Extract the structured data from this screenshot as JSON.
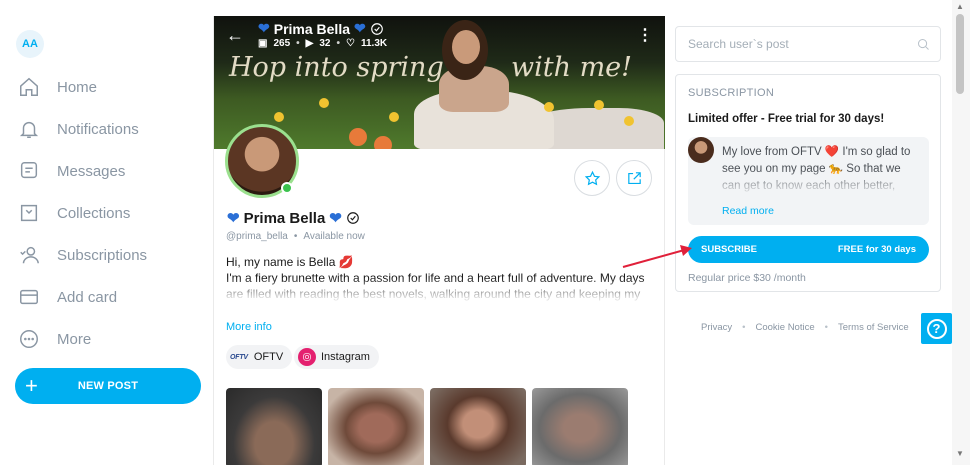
{
  "user": {
    "initials": "AA"
  },
  "nav": {
    "items": [
      {
        "label": "Home",
        "icon": "home-icon"
      },
      {
        "label": "Notifications",
        "icon": "bell-icon"
      },
      {
        "label": "Messages",
        "icon": "message-icon"
      },
      {
        "label": "Collections",
        "icon": "bookmark-icon"
      },
      {
        "label": "Subscriptions",
        "icon": "subscriptions-icon"
      },
      {
        "label": "Add card",
        "icon": "card-icon"
      },
      {
        "label": "More",
        "icon": "more-icon"
      }
    ],
    "new_post": "NEW POST"
  },
  "cover": {
    "name": "Prima Bella",
    "photos": "265",
    "videos": "32",
    "likes": "11.3K",
    "script_left": "Hop into spring",
    "script_right": "with me!"
  },
  "profile": {
    "name": "Prima Bella",
    "handle": "@prima_bella",
    "status": "Available now",
    "bio_line1": "Hi, my name is Bella",
    "bio_line2": "I'm a fiery brunette with a passion for life and a heart full of adventure. My days are filled with reading the best novels, walking around the city and keeping my",
    "more_info": "More info",
    "links": [
      {
        "label": "OFTV",
        "logo": "OFTV"
      },
      {
        "label": "Instagram"
      }
    ]
  },
  "search": {
    "placeholder": "Search user`s post"
  },
  "subscription": {
    "title": "SUBSCRIPTION",
    "offer": "Limited offer - Free trial for 30 days!",
    "message": "My love from OFTV ❤️ I'm so glad to see you on my page 🐆 So that we can get to know each other better,",
    "read_more": "Read more",
    "button_label": "SUBSCRIBE",
    "button_price": "FREE for 30 days",
    "regular_price": "Regular price $30 /month"
  },
  "footer": {
    "links": [
      "Privacy",
      "Cookie Notice",
      "Terms of Service"
    ]
  },
  "colors": {
    "accent": "#00aff0",
    "text_muted": "#8a96a3",
    "online": "#3bc24e",
    "annotation_arrow": "#e0203a"
  }
}
